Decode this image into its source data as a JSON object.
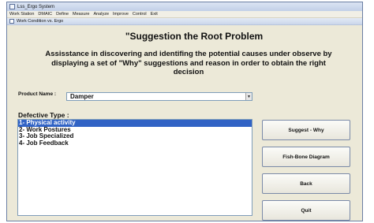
{
  "window": {
    "title": "Lss_Ergo System"
  },
  "menu": {
    "items": [
      "Work Station",
      "DMAIC",
      "Define",
      "Measure",
      "Analyze",
      "Improve",
      "Control",
      "Exit"
    ]
  },
  "child_window": {
    "title": "Work Condition vs. Ergo"
  },
  "form": {
    "heading": "\"Suggestion the Root Problem",
    "description": "Assisstance in discovering and identifing the potential causes under observe by displaying a set of \"Why\" suggestions and reason in order to obtain the right decision",
    "product_label": "Product Name :",
    "product_value": "Damper",
    "defective_label": "Defective Type :",
    "defective_items": [
      "1- Physical activity",
      "2- Work Postures",
      "3- Job Specialized",
      "4- Job Feedback"
    ],
    "selected_index": 0
  },
  "buttons": {
    "suggest": "Suggest - Why",
    "fish": "Fish-Bone Diagram",
    "back": "Back",
    "quit": "Quit"
  },
  "icons": {
    "app": "app-icon",
    "child": "document-icon",
    "dropdown": "chevron-down-icon"
  },
  "colors": {
    "selection": "#3163c5",
    "panel": "#ece9d8"
  }
}
